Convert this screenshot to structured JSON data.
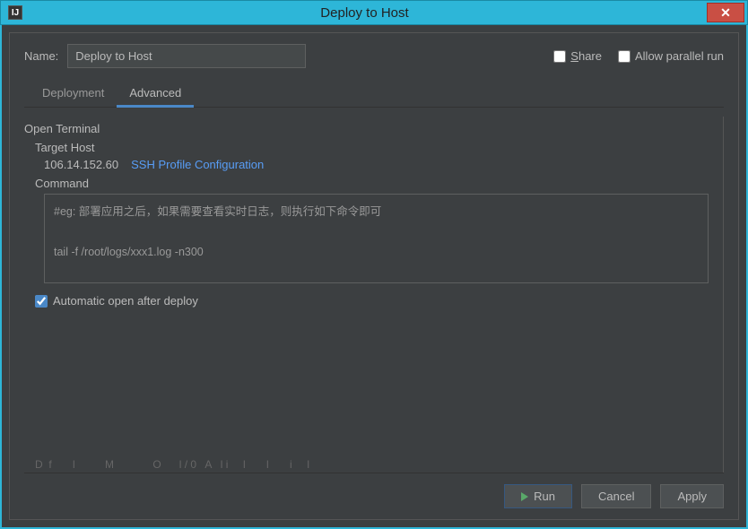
{
  "titlebar": {
    "title": "Deploy to Host",
    "close": "✕"
  },
  "form": {
    "name_label": "Name:",
    "name_value": "Deploy to Host",
    "share_label_pre": "",
    "share_label_mnem": "S",
    "share_label_post": "hare",
    "parallel_label": "Allow parallel run"
  },
  "tabs": {
    "deployment": "Deployment",
    "advanced": "Advanced"
  },
  "content": {
    "open_terminal": "Open Terminal",
    "target_host_label": "Target Host",
    "target_host_ip": "106.14.152.60",
    "ssh_link": "SSH Profile Configuration",
    "command_label": "Command",
    "command_text": "#eg: 部署应用之后，如果需要查看实时日志，则执行如下命令即可\n\ntail -f /root/logs/xxx1.log -n300",
    "auto_open_label": "Automatic open after deploy",
    "faint": "D  f       l          M             O      l / 0   A   l i     l       l       i     l"
  },
  "footer": {
    "run": "Run",
    "cancel": "Cancel",
    "apply": "Apply"
  }
}
